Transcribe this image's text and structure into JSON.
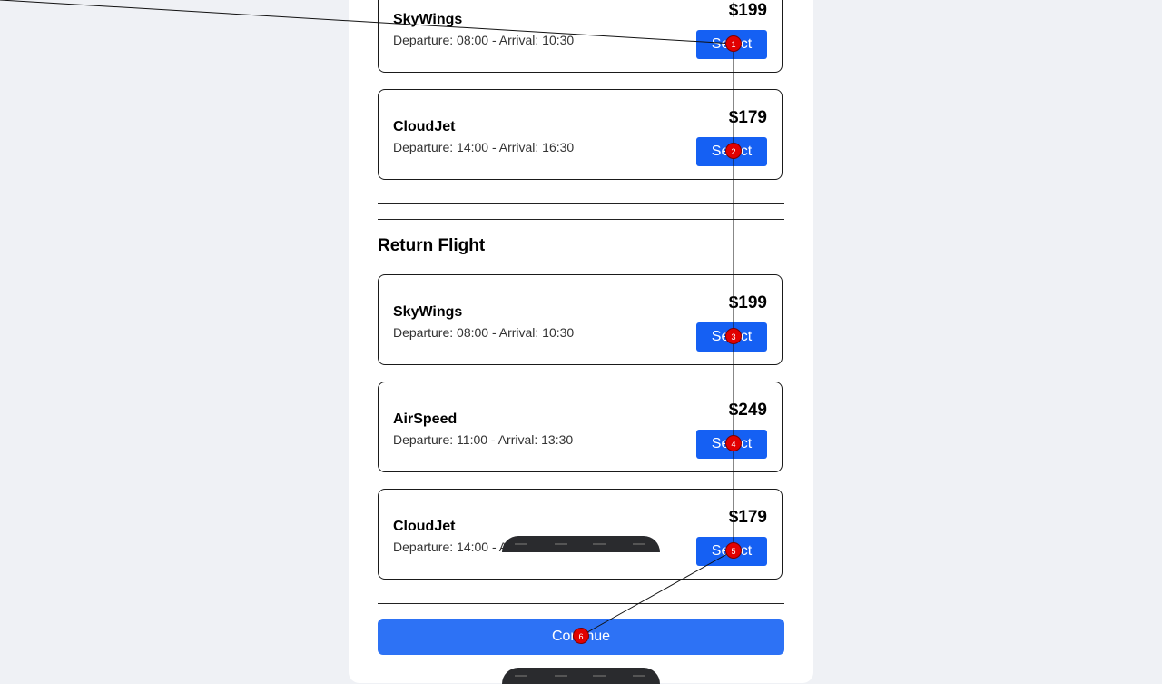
{
  "outbound": {
    "flights": [
      {
        "airline": "SkyWings",
        "times": "Departure: 08:00 - Arrival: 10:30",
        "price": "$199",
        "select_label": "Select"
      },
      {
        "airline": "CloudJet",
        "times": "Departure: 14:00 - Arrival: 16:30",
        "price": "$179",
        "select_label": "Select"
      }
    ]
  },
  "return": {
    "title": "Return Flight",
    "flights": [
      {
        "airline": "SkyWings",
        "times": "Departure: 08:00 - Arrival: 10:30",
        "price": "$199",
        "select_label": "Select"
      },
      {
        "airline": "AirSpeed",
        "times": "Departure: 11:00 - Arrival: 13:30",
        "price": "$249",
        "select_label": "Select"
      },
      {
        "airline": "CloudJet",
        "times": "Departure: 14:00 - Arrival: 16:30",
        "price": "$179",
        "select_label": "Select"
      }
    ]
  },
  "continue_label": "Continue",
  "markers": [
    "1",
    "2",
    "3",
    "4",
    "5",
    "6"
  ],
  "colors": {
    "accent": "#1560f3",
    "marker": "#e10000"
  }
}
